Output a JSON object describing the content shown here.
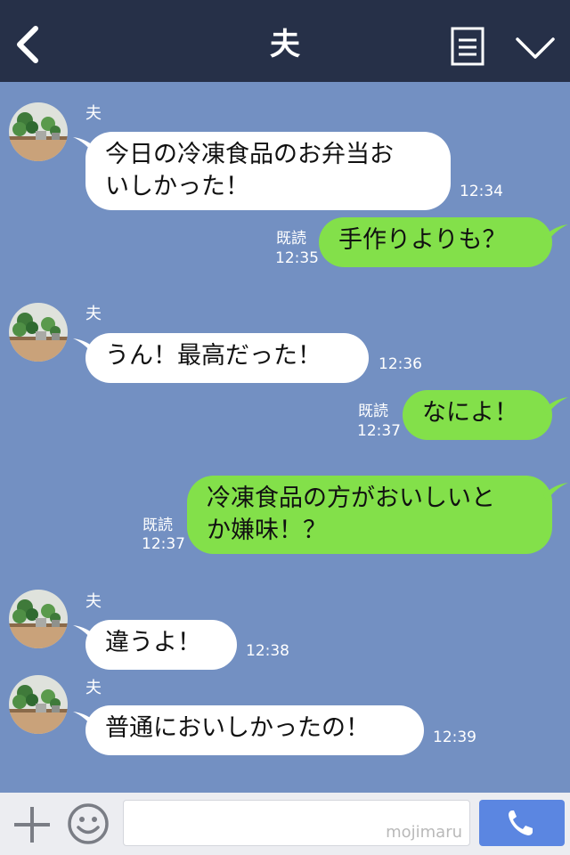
{
  "header": {
    "title": "夫"
  },
  "messages": [
    {
      "sender": "夫",
      "text_lines": [
        "今日の冷凍食品のお弁当お",
        "いしかった！"
      ],
      "time": "12:34"
    },
    {
      "text": "手作りよりも？",
      "read": "既読",
      "time": "12:35"
    },
    {
      "sender": "夫",
      "text": "うん！最高だった！",
      "time": "12:36"
    },
    {
      "text": "なによ！",
      "read": "既読",
      "time": "12:37"
    },
    {
      "text_lines": [
        "冷凍食品の方がおいしいと",
        "か嫌味！？"
      ],
      "read": "既読",
      "time": "12:37"
    },
    {
      "sender": "夫",
      "text": "違うよ！",
      "time": "12:38"
    },
    {
      "sender": "夫",
      "text": "普通においしかったの！",
      "time": "12:39"
    }
  ],
  "footer": {
    "watermark": "mojimaru"
  },
  "colors": {
    "header": "#263048",
    "chat_bg": "#7390c2",
    "outgoing": "#83e04a",
    "incoming": "#ffffff",
    "call": "#5b86e1"
  },
  "icons": [
    "back-icon",
    "menu-icon",
    "chevron-down-icon",
    "plus-icon",
    "smile-icon",
    "phone-icon"
  ]
}
